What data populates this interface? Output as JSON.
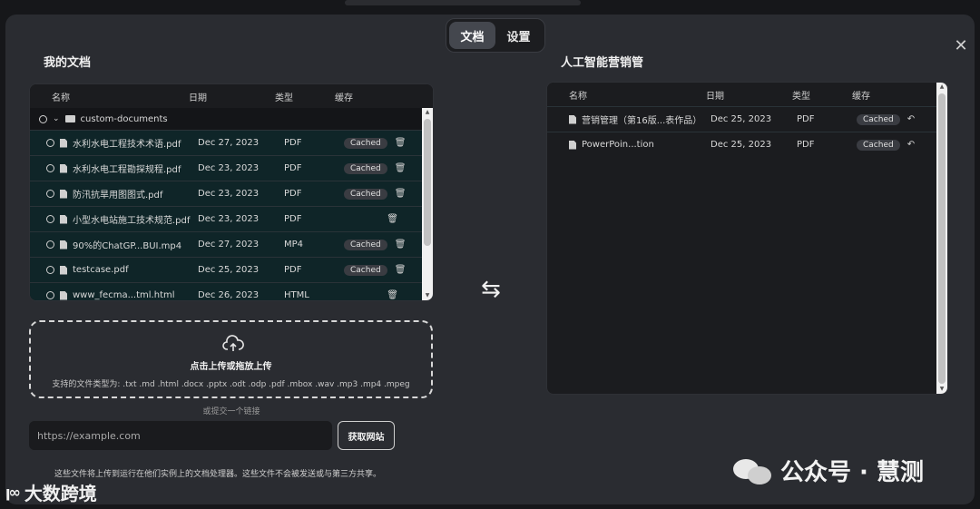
{
  "tabs": [
    {
      "label": "文档"
    },
    {
      "label": "设置"
    }
  ],
  "left_panel": {
    "title": "我的文档",
    "headers": {
      "name": "名称",
      "date": "日期",
      "type": "类型",
      "cache": "缓存"
    },
    "folder": "custom-documents",
    "rows": [
      {
        "name": "水利水电工程技术术语.pdf",
        "date": "Dec 27, 2023",
        "type": "PDF",
        "cache": "Cached"
      },
      {
        "name": "水利水电工程勘探规程.pdf",
        "date": "Dec 23, 2023",
        "type": "PDF",
        "cache": "Cached"
      },
      {
        "name": "防汛抗旱用图图式.pdf",
        "date": "Dec 23, 2023",
        "type": "PDF",
        "cache": "Cached"
      },
      {
        "name": "小型水电站施工技术规范.pdf",
        "date": "Dec 23, 2023",
        "type": "PDF",
        "cache": ""
      },
      {
        "name": "90%的ChatGP...BUI.mp4",
        "date": "Dec 27, 2023",
        "type": "MP4",
        "cache": "Cached"
      },
      {
        "name": "testcase.pdf",
        "date": "Dec 25, 2023",
        "type": "PDF",
        "cache": "Cached"
      },
      {
        "name": "www_fecma...tml.html",
        "date": "Dec 26, 2023",
        "type": "HTML",
        "cache": ""
      }
    ]
  },
  "right_panel": {
    "title": "人工智能营销管",
    "headers": {
      "name": "名称",
      "date": "日期",
      "type": "类型",
      "cache": "缓存"
    },
    "rows": [
      {
        "name": "营销管理（第16版...表作品）",
        "date": "Dec 25, 2023",
        "type": "PDF",
        "cache": "Cached"
      },
      {
        "name": "PowerPoin...tion",
        "date": "Dec 25, 2023",
        "type": "PDF",
        "cache": "Cached"
      }
    ]
  },
  "upload": {
    "title": "点击上传或拖放上传",
    "supported": "支持的文件类型为: .txt .md .html .docx .pptx .odt .odp .pdf .mbox .wav .mp3 .mp4 .mpeg"
  },
  "link": {
    "or_text": "或提交一个链接",
    "placeholder": "https://example.com",
    "button": "获取网站"
  },
  "disclaimer": "这些文件将上传到运行在他们实例上的文档处理器。这些文件不会被发送或与第三方共享。",
  "watermark": "公众号 · 慧测",
  "logo": "大数跨境"
}
